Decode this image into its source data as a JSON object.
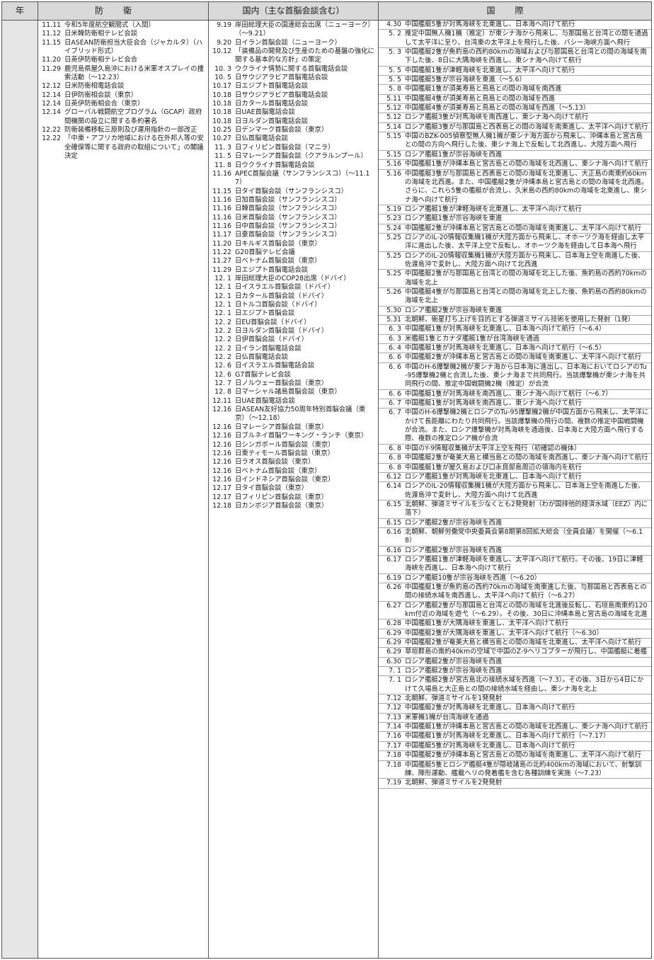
{
  "headers": {
    "year": "年",
    "defense": "防衛",
    "domestic": "国内（主な首脳会談含む）",
    "international": "国際"
  },
  "defense": [
    {
      "d": "11.11",
      "t": "令和5年度航空観閲式（入間）"
    },
    {
      "d": "11.12",
      "t": "日米韓防衛相テレビ会談"
    },
    {
      "d": "11.15",
      "t": "日ASEAN防衛担当大臣会合（ジャカルタ）（ハイブリッド形式）"
    },
    {
      "d": "11.20",
      "t": "日英伊防衛相テレビ会合"
    },
    {
      "d": "11.29",
      "t": "鹿児島県屋久島沖における米軍オスプレイの捜索活動（～12.23）"
    },
    {
      "d": "12.12",
      "t": "日米防衛相電話会談"
    },
    {
      "d": "12.14",
      "t": "日伊防衛相会談（東京）"
    },
    {
      "d": "12.14",
      "t": "日英伊防衛相会合（東京）"
    },
    {
      "d": "12.14",
      "t": "グローバル戦闘航空プログラム（GCAP）政府間機関の設立に関する条約署名"
    },
    {
      "d": "12.22",
      "t": "防衛装備移転三原則及び運用指針の一部改正"
    },
    {
      "d": "12.22",
      "t": "「中東・アフリカ地域における在外邦人等の安全確保等に関する政府の取組について」の閣議決定"
    }
  ],
  "domestic": [
    {
      "d": "9.19",
      "t": "岸田総理大臣の国連総会出席（ニューヨーク）（～9.21）"
    },
    {
      "d": "9.20",
      "t": "日イラン首脳会談（ニューヨーク）"
    },
    {
      "d": "10.12",
      "t": "「装備品の開発及び生産のための基盤の強化に関する基本的な方針」の策定"
    },
    {
      "d": "10. 3",
      "t": "ウクライナ情勢に関する首脳電話会談"
    },
    {
      "d": "10. 5",
      "t": "日サウジアラビア首脳電話会談"
    },
    {
      "d": "10.17",
      "t": "日エジプト首脳電話会談"
    },
    {
      "d": "10.18",
      "t": "日サウジアラビア首脳電話会談"
    },
    {
      "d": "10.18",
      "t": "日カタール首脳電話会談"
    },
    {
      "d": "10.18",
      "t": "日UAE首脳電話会談"
    },
    {
      "d": "10.18",
      "t": "日ヨルダン首脳電話会談"
    },
    {
      "d": "10.25",
      "t": "日デンマーク首脳会談（東京）"
    },
    {
      "d": "10.27",
      "t": "日仏首脳電話会談"
    },
    {
      "d": "11. 3",
      "t": "日フィリピン首脳会談（マニラ）"
    },
    {
      "d": "11. 5",
      "t": "日マレーシア首脳会談（クアラルンプール）"
    },
    {
      "d": "11. 8",
      "t": "日ウクライナ首脳電話会談"
    },
    {
      "d": "11.16",
      "t": "APEC首脳会議（サンフランシスコ）（～11.17）"
    },
    {
      "d": "11.15",
      "t": "日タイ首脳会談（サンフランシスコ）"
    },
    {
      "d": "11.16",
      "t": "日加首脳会談（サンフランシスコ）"
    },
    {
      "d": "11.16",
      "t": "日韓首脳会談（サンフランシスコ）"
    },
    {
      "d": "11.16",
      "t": "日米首脳会談（サンフランシスコ）"
    },
    {
      "d": "11.16",
      "t": "日中首脳会談（サンフランシスコ）"
    },
    {
      "d": "11.17",
      "t": "日豪首脳会談（サンフランシスコ）"
    },
    {
      "d": "11.20",
      "t": "日キルギス首脳会談（東京）"
    },
    {
      "d": "11.22",
      "t": "G20首脳テレビ会議"
    },
    {
      "d": "11.27",
      "t": "日ベトナム首脳会談（東京）"
    },
    {
      "d": "11.29",
      "t": "日エジプト首脳電話会談"
    },
    {
      "d": "12. 1",
      "t": "岸田総理大臣のCOP28出席（ドバイ）"
    },
    {
      "d": "12. 1",
      "t": "日イスラエル首脳会談（ドバイ）"
    },
    {
      "d": "12. 1",
      "t": "日カタール首脳会談（ドバイ）"
    },
    {
      "d": "12. 1",
      "t": "日トルコ首脳会談（ドバイ）"
    },
    {
      "d": "12. 1",
      "t": "日エジプト首脳会談"
    },
    {
      "d": "12. 2",
      "t": "日EU首脳会談（ドバイ）"
    },
    {
      "d": "12. 2",
      "t": "日ヨルダン首脳会談（ドバイ）"
    },
    {
      "d": "12. 2",
      "t": "日伊首脳会談（ドバイ）"
    },
    {
      "d": "12. 2",
      "t": "日イラン首脳電話会談"
    },
    {
      "d": "12. 2",
      "t": "日仏首脳電話会談"
    },
    {
      "d": "12. 6",
      "t": "日イスラエル首脳電話会談"
    },
    {
      "d": "12. 6",
      "t": "G7首脳テレビ会談"
    },
    {
      "d": "12. 7",
      "t": "日ノルウェー首脳会談（東京）"
    },
    {
      "d": "12. 8",
      "t": "日マーシャル諸島首脳会談（東京）"
    },
    {
      "d": "12.11",
      "t": "日UAE首脳電話会談"
    },
    {
      "d": "12.16",
      "t": "日ASEAN友好協力50周年特別首脳会議（東京）（～12.18）"
    },
    {
      "d": "12.16",
      "t": "日マレーシア首脳会談（東京）"
    },
    {
      "d": "12.16",
      "t": "日ブルネイ首脳ワーキング・ランチ（東京）"
    },
    {
      "d": "12.16",
      "t": "日シンガポール首脳会談（東京）"
    },
    {
      "d": "12.16",
      "t": "日東ティモール首脳会談（東京）"
    },
    {
      "d": "12.16",
      "t": "日ラオス首脳会談（東京）"
    },
    {
      "d": "12.16",
      "t": "日ベトナム首脳会談（東京）"
    },
    {
      "d": "12.16",
      "t": "日インドネシア首脳会談（東京）"
    },
    {
      "d": "12.17",
      "t": "日タイ首脳会談（東京）"
    },
    {
      "d": "12.17",
      "t": "日フィリピン首脳会談（東京）"
    },
    {
      "d": "12.18",
      "t": "日カンボジア首脳会談（東京）"
    }
  ],
  "international": [
    {
      "d": "4.30",
      "t": "中国艦艇5隻が対馬海峡を北東進し、日本海へ向けて航行"
    },
    {
      "d": "5. 2",
      "t": "推定中国無人機1機（推定）が東シナ海から飛来し、与那国島と台湾との間を通過して太平洋に至り、台湾東の太平洋上を飛行した後、バシー海峡方面へ飛行"
    },
    {
      "d": "5. 3",
      "t": "中国艦艇2隻が魚釣島の西約80kmの海域および与那国島と台湾との間の海域を南下した後、8日に大隅海峡を西進し、東シナ海へ向けて航行"
    },
    {
      "d": "5. 5",
      "t": "中国艦艇1隻が津軽海峡を北東進し、太平洋へ向けて航行"
    },
    {
      "d": "5. 5",
      "t": "中国艦艇5隻が宗谷海峡を東進（～5.6）"
    },
    {
      "d": "5. 8",
      "t": "中国艦艇1隻が須美寿島と鳥島との間の海域を南西進"
    },
    {
      "d": "5.11",
      "t": "中国艦艇4隻が須美寿島と鳥島との間の海域を西進"
    },
    {
      "d": "5.12",
      "t": "中国艦艇4隻が須美寿島と鳥島との間の海域を西進（～5.13）"
    },
    {
      "d": "5.12",
      "t": "ロシア艦艇3隻が対馬海峡を南西進し、東シナ海へ向けて航行"
    },
    {
      "d": "5.14",
      "t": "ロシア艦艇3隻が与那国島と西表島との間の海域を南東進し、太平洋へ向けて航行"
    },
    {
      "d": "5.15",
      "t": "中国のBZK-005偵察型無人機1機が東シナ海方面から飛来し、沖縄本島と宮古島との間の方向へ飛行した後、東シナ海上で反転して北西進し、大陸方面へ飛行"
    },
    {
      "d": "5.15",
      "t": "ロシア艦艇1隻が宗谷海峡を西進"
    },
    {
      "d": "5.16",
      "t": "中国艦艇1隻が沖縄本島と宮古島との間の海域を北西進し、東シナ海へ向けて航行"
    },
    {
      "d": "5.16",
      "t": "中国艦艇3隻が与那国島と西表島との間の海域を北東進し、大正島の南東約60kmの海域を北西進。また、中国艦艇2隻が沖縄本島と宮古島との間の海域を北西進。さらに、これら5隻の艦艇が合流し、久米島の西約80kmの海域を北東進し、東シナ海へ向けて航行"
    },
    {
      "d": "5.19",
      "t": "ロシア艦艇1隻が津軽海峡を北東進し、太平洋へ向けて航行"
    },
    {
      "d": "5.23",
      "t": "ロシア艦艇1隻が宗谷海峡を東進"
    },
    {
      "d": "5.24",
      "t": "中国艦艇2隻が沖縄本島と宮古島との間の海域を南東進し、太平洋へ向けて航行"
    },
    {
      "d": "5.25",
      "t": "ロシアのIL-20情報収集機1機が大陸方面から飛来し、オホーツク海を経由し太平洋に進出した後、太平洋上空で反転し、オホーツク海を経由して日本海へ飛行"
    },
    {
      "d": "5.25",
      "t": "ロシアのIL-20情報収集機1機が大陸方面から飛来し、日本海上空を南進した後、佐渡島沖で変針し、大陸方面へ向けて北西進"
    },
    {
      "d": "5.25",
      "t": "中国艦艇2隻が与那国島と台湾との間の海域を北上した後、魚釣島の西約70kmの海域を北上"
    },
    {
      "d": "5.26",
      "t": "中国艦艇4隻が与那国島と台湾との間の海域を北上した後、魚釣島の西約80kmの海域を北上"
    },
    {
      "d": "5.30",
      "t": "ロシア艦艇2隻が宗谷海峡を東進"
    },
    {
      "d": "5.31",
      "t": "北朝鮮、衛星打ち上げを目的とする弾道ミサイル技術を使用した発射（1発）"
    },
    {
      "d": "6. 3",
      "t": "中国艦艇1隻が対馬海峡を北東進し、日本海へ向けて航行（～6.4）"
    },
    {
      "d": "6. 3",
      "t": "米艦艇1隻とカナダ艦艇1隻が台湾海峡を通過"
    },
    {
      "d": "6. 4",
      "t": "中国艦艇1隻が対馬海峡を北東進し、日本海へ向けて航行（～6.5）"
    },
    {
      "d": "6. 6",
      "t": "中国艦艇2隻が沖縄本島と宮古島との間の海域を南東進し、太平洋へ向けて航行"
    },
    {
      "d": "6. 6",
      "t": "中国のH-6爆撃機2機が東シナ海から日本海に進出し、日本海においてロシアのTu-95爆撃機2機と合流した後、東シナ海まで共同飛行。当該爆撃機が東シナ海を共同飛行の間、推定中国戦闘機2機（推定）が合流"
    },
    {
      "d": "6. 6",
      "t": "中国艦艇1隻が対馬海峡を南西進し、東シナ海へ向けて航行（～6.7）"
    },
    {
      "d": "6. 7",
      "t": "中国艦艇1隻が対馬海峡を南西進し、東シナ海へ向けて航行"
    },
    {
      "d": "6. 7",
      "t": "中国のH-6爆撃機2機とロシアのTu-95爆撃機2機が中国方面から飛来し、太平洋にかけて長距離にわたり共同飛行。当該爆撃機の飛行の間、複数の推定中国戦闘機が合流。また、ロシア爆撃機が対馬海峡を通過後、日本海と大陸方面へ飛行する際、複数の推定ロシア機が合流"
    },
    {
      "d": "6. 8",
      "t": "中国のY-9情報収集機が太平洋上空を飛行（初確認の機体）"
    },
    {
      "d": "6. 8",
      "t": "中国艦艇2隻が奄美大島と横当島との間の海域を南西進し、東シナ海へ向けて航行"
    },
    {
      "d": "6. 8",
      "t": "中国艦艇1隻が屋久島および口永良部島周辺の領海内を航行"
    },
    {
      "d": "6.12",
      "t": "ロシア艦艇1隻が対馬海峡を北東進し、日本海へ向けて航行"
    },
    {
      "d": "6.14",
      "t": "ロシアのIL-20情報収集機1機が大陸方面から飛来し、日本海上空を南進した後、佐渡島沖で変針し、大陸方面へ向けて北西進"
    },
    {
      "d": "6.15",
      "t": "北朝鮮、弾道ミサイルを少なくとも2発発射（わが国排他的経済水域（EEZ）内に落下）"
    },
    {
      "d": "6.15",
      "t": "ロシア艦艇2隻が宗谷海峡を西進"
    },
    {
      "d": "6.16",
      "t": "北朝鮮、朝鮮労働党中央委員会第8期第8回拡大総会（全員会議）を開催（～6.18）"
    },
    {
      "d": "6.16",
      "t": "ロシア艦艇2隻が宗谷海峡を西進"
    },
    {
      "d": "6.17",
      "t": "ロシア艦艇1隻が津軽海峡を東進し、太平洋へ向けて航行。その後、19日に津軽海峡を西進し、日本海へ向けて航行"
    },
    {
      "d": "6.19",
      "t": "ロシア艦艇10隻が宗谷海峡を西進（～6.20）"
    },
    {
      "d": "6.26",
      "t": "中国艦艇1隻が魚釣島の西約70kmの海域を南東進した後、与那国島と西表島との間の接続水域を南西進し、太平洋へ向けて航行（～6.27）"
    },
    {
      "d": "6.27",
      "t": "ロシア艦艇2隻が与那国島と台湾との間の海域を北進後反転し、石垣島南東約120km付近の海域を遊弋（～6.29）。その後、30日に沖縄本島と宮古島の海域を北進"
    },
    {
      "d": "6.28",
      "t": "中国艦艇1隻が大隅海峡を東進し、太平洋へ向けて航行"
    },
    {
      "d": "6.29",
      "t": "中国艦艇2隻が大隅海峡を東進し、太平洋へ向けて航行（～6.30）"
    },
    {
      "d": "6.29",
      "t": "中国艦艇2隻が奄美大島と横当島との間の海域を北東進し、太平洋へ向けて航行"
    },
    {
      "d": "6.29",
      "t": "草垣群島の南約40kmの空域で中国のZ-9ヘリコプターが飛行し、中国艦艇に着艦"
    },
    {
      "d": "6.30",
      "t": "ロシア艦艇2隻が宗谷海峡を西進"
    },
    {
      "d": "7. 1",
      "t": "ロシア艦艇2隻が宗谷海峡を西進"
    },
    {
      "d": "7. 1",
      "t": "ロシア艦艇2隻が宮古島北の接続水域を西進（～7.3）。その後、3日から4日にかけて久場島と大正島との間の接続水域を経由し、東シナ海を北上"
    },
    {
      "d": "7.12",
      "t": "北朝鮮、弾道ミサイルを1発発射"
    },
    {
      "d": "7.12",
      "t": "中国艦艇2隻が対馬海峡を北東進し、日本海へ向けて航行"
    },
    {
      "d": "7.13",
      "t": "米軍機1機が台湾海峡を通過"
    },
    {
      "d": "7.14",
      "t": "中国艦艇1隻が沖縄本島と宮古島との間の海域を北西進し、東シナ海へ向けて航行"
    },
    {
      "d": "7.16",
      "t": "中国艦艇1隻が対馬海峡を北東進し、日本海へ向けて航行（～7.17）"
    },
    {
      "d": "7.17",
      "t": "中国艦艇5隻が対馬海峡を北東進し、日本海へ向けて航行"
    },
    {
      "d": "7.18",
      "t": "中国艦艇2隻が沖縄本島と宮古島との間の海域を南東進し、太平洋へ向けて航行"
    },
    {
      "d": "7.18",
      "t": "中国艦艇5隻とロシア艦艇4隻が隠岐諸島の北約400kmの海域において、射撃訓練、陣形運動、艦載ヘリの発着艦を含む各種訓練を実施（～7.23）"
    },
    {
      "d": "7.19",
      "t": "北朝鮮、弾道ミサイルを2発発射"
    }
  ]
}
